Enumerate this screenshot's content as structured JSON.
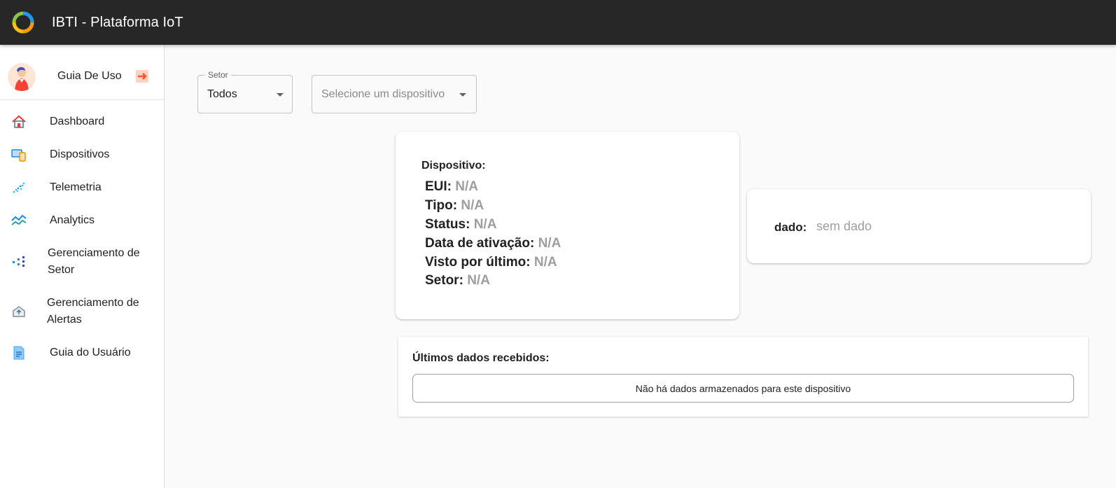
{
  "appbar": {
    "title": "IBTI - Plataforma IoT"
  },
  "user": {
    "name": "Guia De Uso"
  },
  "sidebar": {
    "items": [
      {
        "label": "Dashboard",
        "icon": "home-icon"
      },
      {
        "label": "Dispositivos",
        "icon": "devices-icon"
      },
      {
        "label": "Telemetria",
        "icon": "telemetry-icon"
      },
      {
        "label": "Analytics",
        "icon": "analytics-icon"
      },
      {
        "label": "Gerenciamento de Setor",
        "icon": "sector-management-icon"
      },
      {
        "label": "Gerenciamento de Alertas",
        "icon": "alerts-management-icon"
      },
      {
        "label": "Guia do Usuário",
        "icon": "user-guide-icon"
      }
    ]
  },
  "filters": {
    "setor": {
      "legend": "Setor",
      "value": "Todos"
    },
    "dispositivo": {
      "placeholder": "Selecione um dispositivo"
    }
  },
  "device_card": {
    "heading": "Dispositivo:",
    "rows": [
      {
        "label": "EUI:",
        "value": "N/A"
      },
      {
        "label": "Tipo:",
        "value": "N/A"
      },
      {
        "label": "Status:",
        "value": "N/A"
      },
      {
        "label": "Data de ativação:",
        "value": "N/A"
      },
      {
        "label": "Visto por último:",
        "value": "N/A"
      },
      {
        "label": "Setor:",
        "value": "N/A"
      }
    ]
  },
  "dado_card": {
    "label": "dado:",
    "value": "sem dado"
  },
  "last_data": {
    "title": "Últimos dados recebidos:",
    "empty_message": "Não há dados armazenados para este dispositivo"
  },
  "colors": {
    "appbar": "#272727",
    "accent_logout": "#ff5722",
    "value_gray": "#9e9e9e"
  }
}
